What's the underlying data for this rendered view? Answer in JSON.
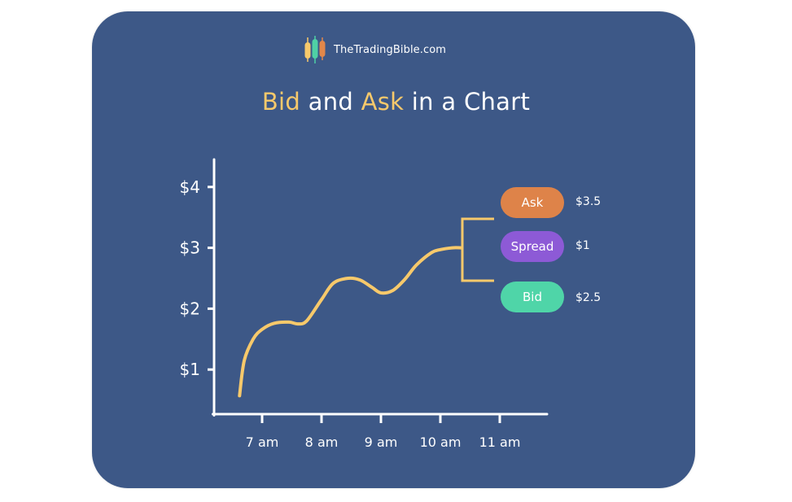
{
  "brand": {
    "name": "TheTradingBible.com",
    "logo_colors": [
      "#f7c96b",
      "#4fd1a5",
      "#e2874a"
    ]
  },
  "title": {
    "part1": "Bid",
    "part2": " and ",
    "part3": "Ask",
    "part4": " in a Chart"
  },
  "legend": [
    {
      "label": "Ask",
      "value": "$3.5",
      "color": "#de8349"
    },
    {
      "label": "Spread",
      "value": "$1",
      "color": "#8d5ad6"
    },
    {
      "label": "Bid",
      "value": "$2.5",
      "color": "#4fd5a8"
    }
  ],
  "colors": {
    "background": "#3d5887",
    "line": "#f7c96b",
    "axis": "#ffffff",
    "highlight": "#f7c96b"
  },
  "chart_data": {
    "type": "line",
    "x_categories": [
      "7 am",
      "8 am",
      "9 am",
      "10 am",
      "11 am"
    ],
    "y_ticks": [
      "$1",
      "$2",
      "$3",
      "$4"
    ],
    "ylim": [
      0,
      4.5
    ],
    "grid": false,
    "series": [
      {
        "x": [
          6.62,
          6.7,
          6.85,
          7.0,
          7.2,
          7.45,
          7.6,
          7.75,
          8.0,
          8.2,
          8.45,
          8.65,
          8.85,
          9.0,
          9.2,
          9.4,
          9.6,
          9.85,
          10.0,
          10.2,
          10.35
        ],
        "y": [
          0.57,
          1.15,
          1.5,
          1.66,
          1.76,
          1.78,
          1.75,
          1.8,
          2.15,
          2.42,
          2.5,
          2.47,
          2.35,
          2.26,
          2.3,
          2.48,
          2.72,
          2.92,
          2.97,
          3.0,
          3.0
        ]
      }
    ],
    "annotations": [
      {
        "label": "Ask",
        "value": "$3.5"
      },
      {
        "label": "Spread",
        "value": "$1"
      },
      {
        "label": "Bid",
        "value": "$2.5"
      }
    ]
  }
}
